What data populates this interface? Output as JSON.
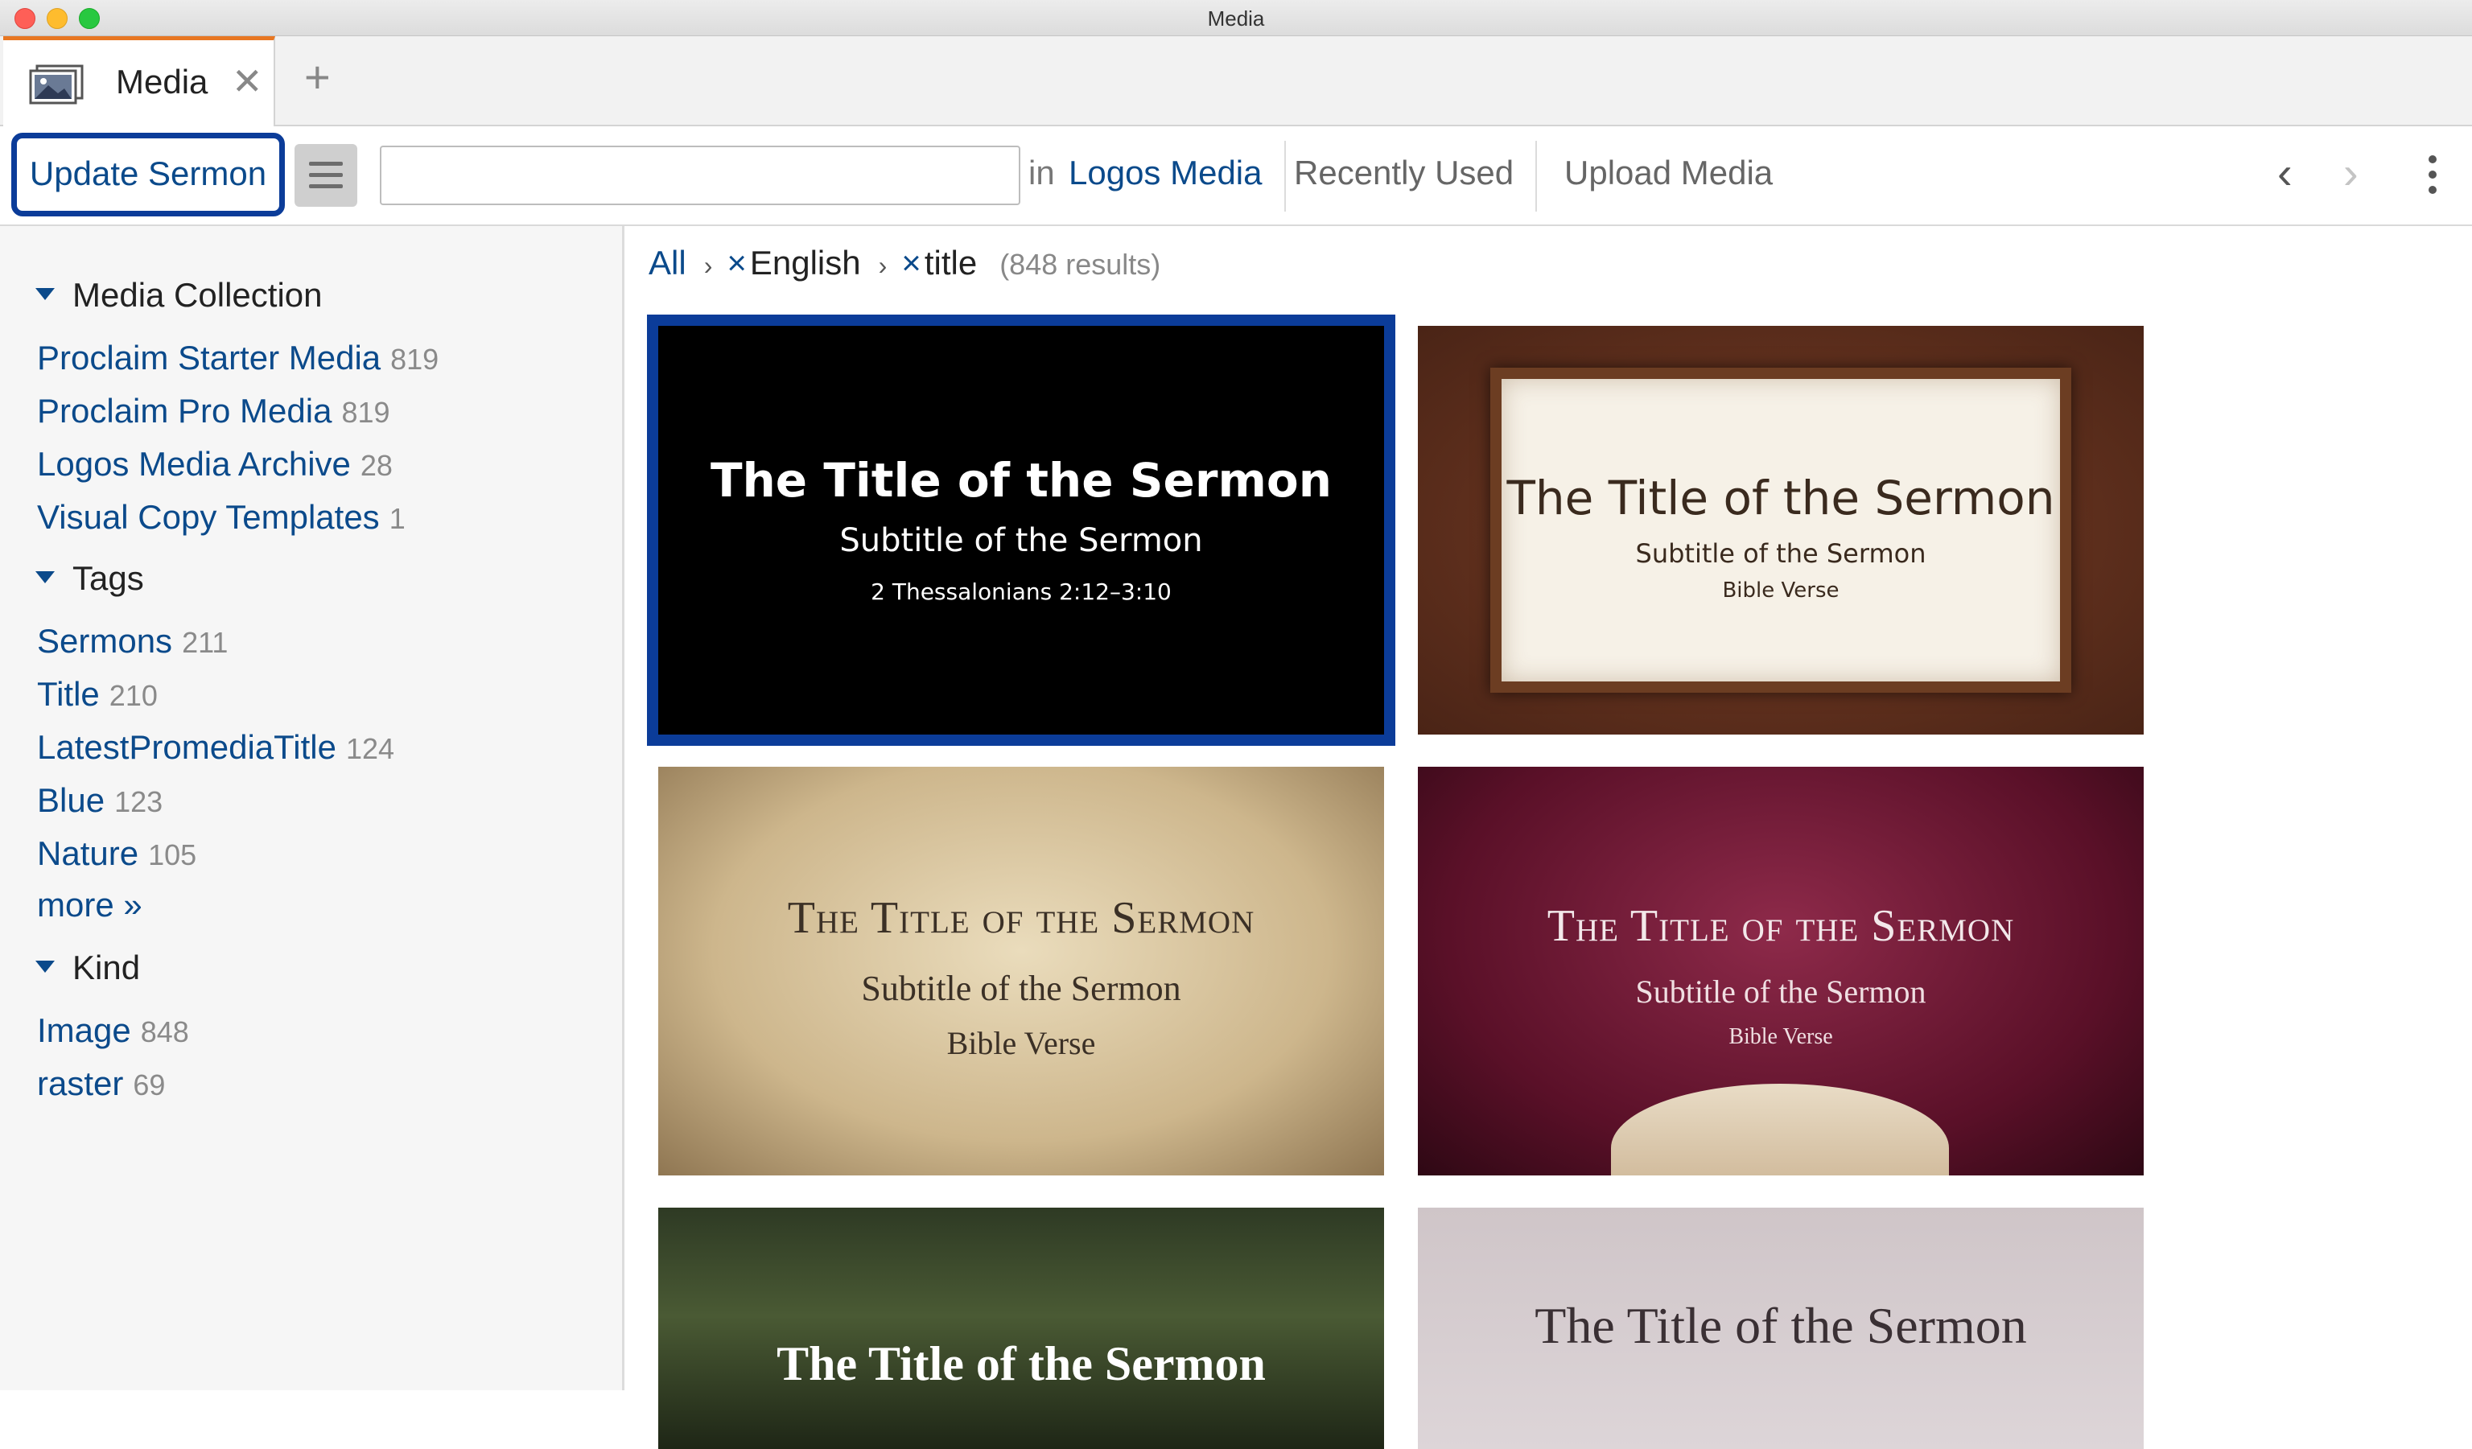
{
  "window": {
    "title": "Media"
  },
  "tabs": [
    {
      "label": "Media",
      "close": "✕"
    }
  ],
  "tab_add": "+",
  "toolbar": {
    "update_label": "Update Sermon",
    "search_value": "",
    "in_label": "in",
    "source_label": "Logos Media",
    "recently_used": "Recently Used",
    "upload_media": "Upload Media",
    "back_arrow": "‹",
    "forward_arrow": "›"
  },
  "sidebar": {
    "sections": [
      {
        "title": "Media Collection",
        "items": [
          {
            "label": "Proclaim Starter Media",
            "count": "819"
          },
          {
            "label": "Proclaim Pro Media",
            "count": "819"
          },
          {
            "label": "Logos Media Archive",
            "count": "28"
          },
          {
            "label": "Visual Copy Templates",
            "count": "1"
          }
        ]
      },
      {
        "title": "Tags",
        "items": [
          {
            "label": "Sermons",
            "count": "211"
          },
          {
            "label": "Title",
            "count": "210"
          },
          {
            "label": "LatestPromediaTitle",
            "count": "124"
          },
          {
            "label": "Blue",
            "count": "123"
          },
          {
            "label": "Nature",
            "count": "105"
          }
        ],
        "more": "more »"
      },
      {
        "title": "Kind",
        "items": [
          {
            "label": "Image",
            "count": "848"
          },
          {
            "label": "raster",
            "count": "69"
          }
        ]
      }
    ]
  },
  "breadcrumb": {
    "all": "All",
    "sep": "›",
    "remove": "×",
    "filters": [
      "English",
      "title"
    ],
    "results": "(848 results)"
  },
  "tiles": [
    {
      "title": "The Title of the Sermon",
      "subtitle": "Subtitle of the Sermon",
      "verse": "2 Thessalonians 2:12–3:10"
    },
    {
      "title": "The Title of the Sermon",
      "subtitle": "Subtitle of the Sermon",
      "verse": "Bible Verse"
    },
    {
      "title": "The Title of the Sermon",
      "subtitle": "Subtitle of the Sermon",
      "verse": "Bible Verse"
    },
    {
      "title": "The Title of the Sermon",
      "subtitle": "Subtitle of the Sermon",
      "verse": "Bible Verse"
    },
    {
      "title": "The Title of the Sermon"
    },
    {
      "title": "The Title of the Sermon"
    }
  ],
  "colors": {
    "accent_tab": "#e87722",
    "link_blue": "#0b4a8b",
    "selection": "#0b3c99"
  }
}
